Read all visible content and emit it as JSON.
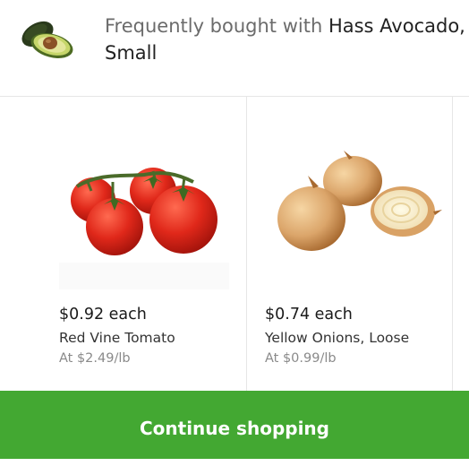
{
  "header": {
    "prefix": "Frequently bought with ",
    "product_name": "Hass Avocado, Small",
    "thumbnail_icon": "avocado-icon"
  },
  "products": [
    {
      "price": "$0.92 each",
      "name": "Red Vine Tomato",
      "unit_price": "At $2.49/lb",
      "image_icon": "tomato-image"
    },
    {
      "price": "$0.74 each",
      "name": "Yellow Onions, Loose",
      "unit_price": "At $0.99/lb",
      "image_icon": "onion-image"
    }
  ],
  "cta": {
    "label": "Continue shopping",
    "color": "#43a832"
  }
}
